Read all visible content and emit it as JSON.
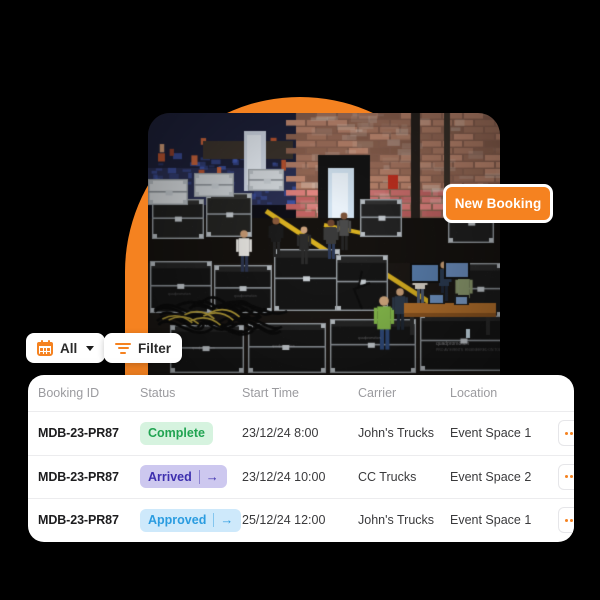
{
  "hero": {
    "photo_alt": "backstage loading area with road cases, crew members and brick walls",
    "accent_color": "#F58220"
  },
  "primary_action": {
    "label": "New Booking",
    "color": "#F58220"
  },
  "filters": {
    "date_filter": {
      "label": "All",
      "icon": "calendar-icon",
      "chevron": "chevron-down-icon"
    },
    "filter_button": {
      "label": "Filter",
      "icon": "filter-icon"
    }
  },
  "table": {
    "columns": [
      "Booking ID",
      "Status",
      "Start Time",
      "Carrier",
      "Location"
    ],
    "rows": [
      {
        "booking_id": "MDB-23-PR87",
        "status": "Complete",
        "status_variant": "green",
        "status_has_arrow": false,
        "start_time": "23/12/24 8:00",
        "carrier": "John's Trucks",
        "location": "Event Space 1",
        "actions": "•••"
      },
      {
        "booking_id": "MDB-23-PR87",
        "status": "Arrived",
        "status_variant": "purple",
        "status_has_arrow": true,
        "start_time": "23/12/24 10:00",
        "carrier": "CC Trucks",
        "location": "Event Space 2",
        "actions": "•••"
      },
      {
        "booking_id": "MDB-23-PR87",
        "status": "Approved",
        "status_variant": "blue",
        "status_has_arrow": true,
        "start_time": "25/12/24 12:00",
        "carrier": "John's Trucks",
        "location": "Event Space 1",
        "actions": "•••"
      }
    ],
    "status_arrow_glyph": "→"
  },
  "colors": {
    "background": "#000000",
    "card": "#ffffff",
    "accent": "#F58220",
    "status_green_bg": "#d6f3df",
    "status_green_fg": "#21a452",
    "status_purple_bg": "#cdc8ef",
    "status_purple_fg": "#3d2fae",
    "status_blue_bg": "#cee9fb",
    "status_blue_fg": "#2a9ce0"
  }
}
